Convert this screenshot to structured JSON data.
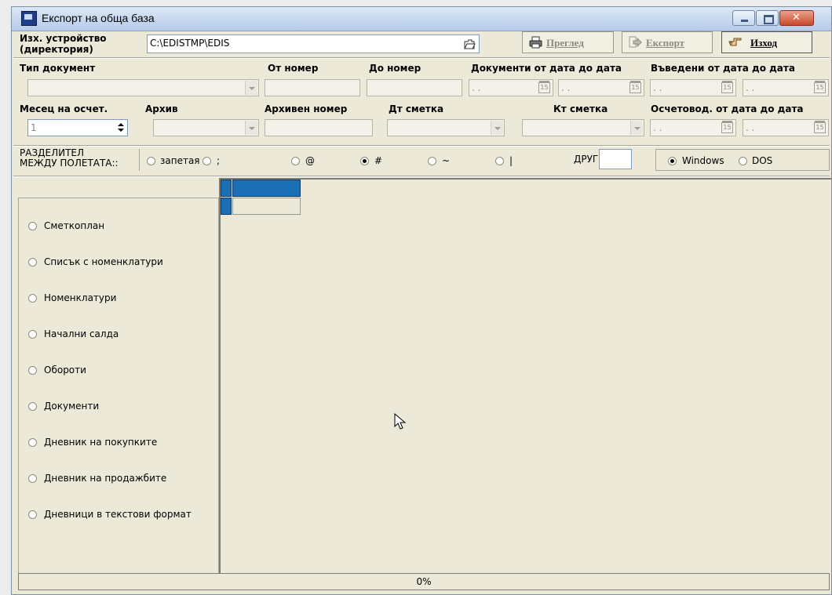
{
  "window": {
    "title": "Експорт на обща база"
  },
  "device": {
    "label": "Изх. устройство (директория)",
    "label_line1": "Изх. устройство",
    "label_line2": "(директория)",
    "path": "C:\\EDISTMP\\EDIS"
  },
  "buttons": {
    "preview": "Преглед",
    "export": "Експорт",
    "exit": "Изход"
  },
  "filters": {
    "doc_type": "Тип документ",
    "from_number": "От номер",
    "to_number": "До номер",
    "docs_date_range": "Документи от дата до дата",
    "entered_date_range": "Въведени от дата до дата",
    "month": "Месец на осчет.",
    "month_value": "1",
    "archive": "Архив",
    "archive_number": "Архивен номер",
    "debit_account": "Дт сметка",
    "credit_account": "Кт сметка",
    "accounted_date_range": "Осчетовод. от дата до дата",
    "date_placeholder": ". .",
    "calendar_glyph": "15"
  },
  "separator": {
    "label_line1": "РАЗДЕЛИТЕЛ",
    "label_line2": "МЕЖДУ ПОЛЕТАТА::",
    "options": [
      "запетая",
      ";",
      "@",
      "#",
      "~",
      "|"
    ],
    "selected": "#",
    "other_label": "ДРУГ:",
    "other_value": ""
  },
  "encoding": {
    "options": [
      "Windows",
      "DOS"
    ],
    "selected": "Windows"
  },
  "export_types": [
    "Сметкоплан",
    "Списък с номенклатури",
    "Номенклатури",
    "Начални салда",
    "Обороти",
    "Документи",
    "Дневник на покупките",
    "Дневник на продажбите",
    "Дневници в текстови формат"
  ],
  "progress": {
    "text": "0%",
    "value": 0
  },
  "icons": {
    "app": "app-window-icon",
    "folder": "folder-open-icon",
    "preview": "printer-icon",
    "export": "export-arrow-icon",
    "exit": "pointing-hand-icon"
  }
}
